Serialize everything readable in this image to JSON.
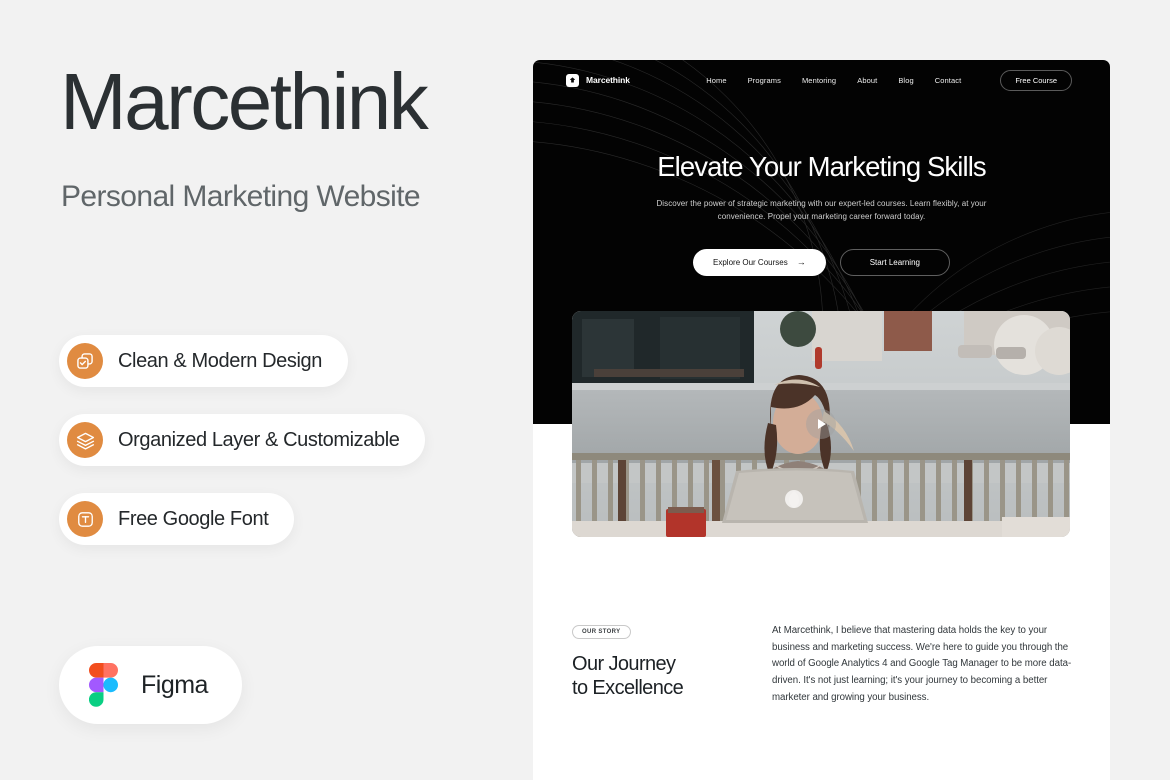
{
  "presentation": {
    "title": "Marcethink",
    "subtitle": "Personal Marketing Website",
    "features": [
      {
        "label": "Clean & Modern Design",
        "icon": "duplicate-icon"
      },
      {
        "label": "Organized Layer & Customizable",
        "icon": "layers-icon"
      },
      {
        "label": "Free Google Font",
        "icon": "text-font-icon"
      }
    ],
    "tool": {
      "label": "Figma",
      "icon": "figma-logo"
    },
    "colors": {
      "background": "#f2f2f2",
      "accent": "#e08b41",
      "title": "#2b3033",
      "subtitle": "#606669"
    }
  },
  "website": {
    "nav": {
      "brand": "Marcethink",
      "links": [
        "Home",
        "Programs",
        "Mentoring",
        "About",
        "Blog",
        "Contact"
      ],
      "cta": "Free Course"
    },
    "hero": {
      "title": "Elevate Your Marketing Skills",
      "subtitle": "Discover the power of strategic marketing with our expert-led courses. Learn flexibly, at your convenience. Propel your marketing career forward today.",
      "primary_button": "Explore Our Courses",
      "primary_button_arrow": "→",
      "secondary_button": "Start Learning",
      "background": "#030303"
    },
    "video": {
      "alt": "Woman working on a laptop at an outdoor cafe table",
      "play_label": "play-button"
    },
    "story": {
      "badge": "OUR STORY",
      "heading_line1": "Our Journey",
      "heading_line2": "to Excellence",
      "paragraph": "At Marcethink, I believe that mastering data holds the key to your business and marketing success. We're here to guide you through the world of Google Analytics 4 and Google Tag Manager to be more data-driven. It's not just learning; it's your journey to becoming a better marketer and growing your business."
    }
  }
}
